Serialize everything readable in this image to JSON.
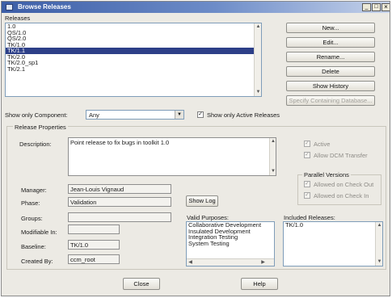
{
  "window": {
    "title": "Browse Releases",
    "controls": {
      "minimize": "_",
      "maximize": "□",
      "close": "×"
    }
  },
  "releases": {
    "label": "Releases",
    "items": [
      "1.0",
      "QS/1.0",
      "QS/2.0",
      "TK/1.0",
      "TK/1.1",
      "TK/2.0",
      "TK/2.0_sp1",
      "TK/2.1"
    ],
    "selected_index": 4
  },
  "buttons": {
    "new": "New...",
    "edit": "Edit...",
    "rename": "Rename...",
    "delete": "Delete",
    "show_history": "Show History",
    "specify_database": "Specify Containing Database..."
  },
  "filter": {
    "component_label": "Show only Component:",
    "component_value": "Any",
    "active_only_label": "Show only Active Releases",
    "active_only_checked": true
  },
  "properties": {
    "title": "Release Properties",
    "description_label": "Description:",
    "description": "Point release to fix bugs in toolkit 1.0",
    "active_label": "Active",
    "active_checked": true,
    "allow_dcm_label": "Allow DCM Transfer",
    "allow_dcm_checked": true,
    "parallel": {
      "title": "Parallel Versions",
      "checkout_label": "Allowed on Check Out",
      "checkout_checked": true,
      "checkin_label": "Allowed on Check In",
      "checkin_checked": true
    },
    "manager_label": "Manager:",
    "manager": "Jean-Louis Vignaud",
    "phase_label": "Phase:",
    "phase": "Validation",
    "show_log": "Show Log",
    "groups_label": "Groups:",
    "groups": "",
    "modifiable_label": "Modifiable In:",
    "modifiable": "",
    "baseline_label": "Baseline:",
    "baseline": "TK/1.0",
    "created_by_label": "Created By:",
    "created_by": "ccm_root",
    "valid_purposes": {
      "label": "Valid Purposes:",
      "items": [
        "Collaborative Development",
        "Insulated Development",
        "Integration Testing",
        "System Testing"
      ]
    },
    "included_releases": {
      "label": "Included Releases:",
      "items": [
        "TK/1.0"
      ]
    }
  },
  "footer": {
    "close": "Close",
    "help": "Help"
  }
}
